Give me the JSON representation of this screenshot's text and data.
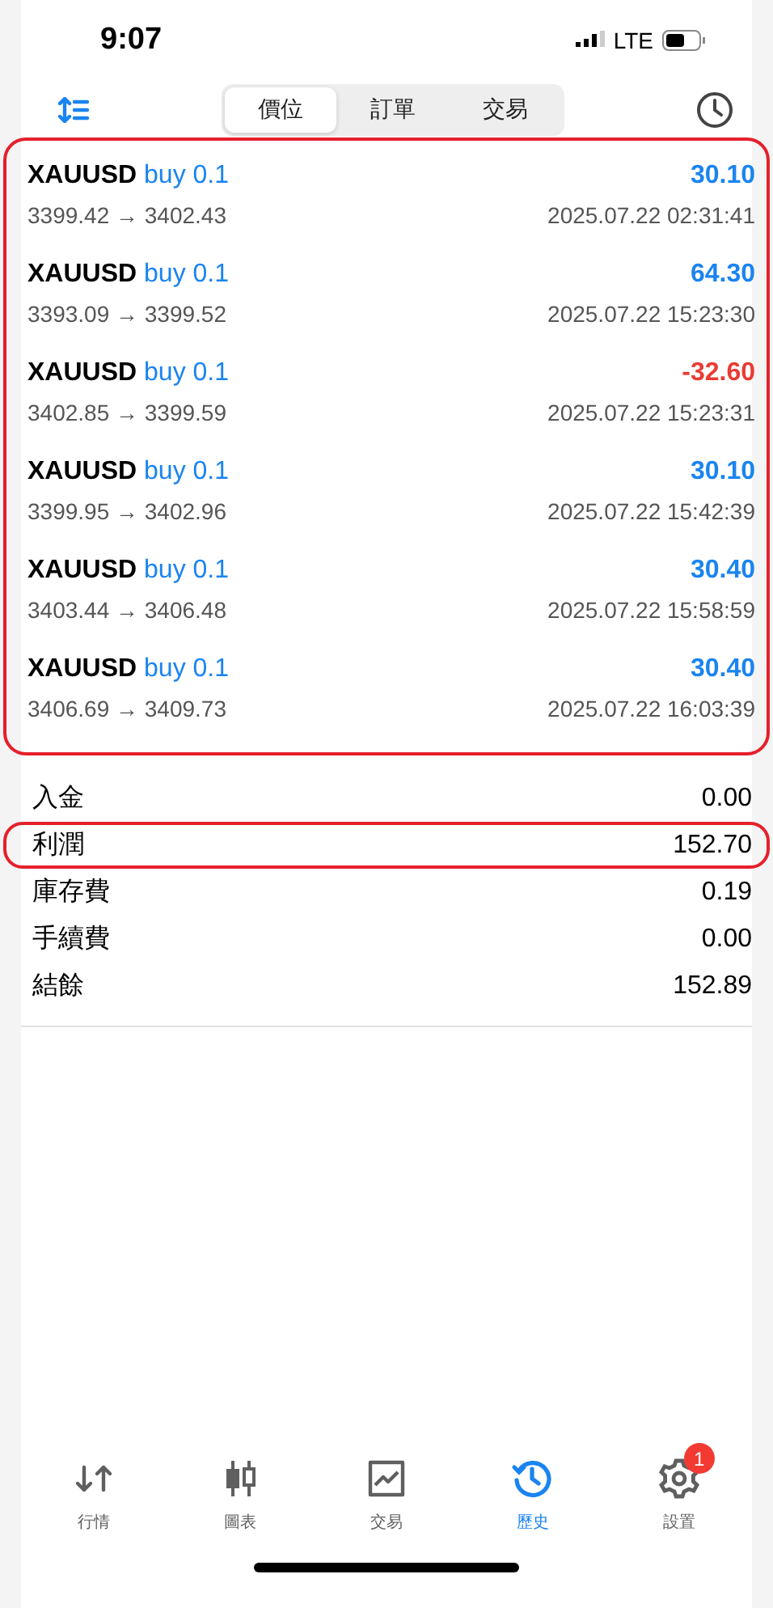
{
  "status_bar": {
    "time": "9:07",
    "network": "LTE"
  },
  "segments": [
    {
      "label": "價位",
      "selected": true
    },
    {
      "label": "訂單",
      "selected": false
    },
    {
      "label": "交易",
      "selected": false
    }
  ],
  "trades_highlighted": true,
  "trades": [
    {
      "symbol": "XAUUSD",
      "side": "buy 0.1",
      "prices": "3399.42 → 3402.43",
      "profit": "30.10",
      "color": "#1a84f0",
      "time": "2025.07.22 02:31:41"
    },
    {
      "symbol": "XAUUSD",
      "side": "buy 0.1",
      "prices": "3393.09 → 3399.52",
      "profit": "64.30",
      "color": "#1a84f0",
      "time": "2025.07.22 15:23:30"
    },
    {
      "symbol": "XAUUSD",
      "side": "buy 0.1",
      "prices": "3402.85 → 3399.59",
      "profit": "-32.60",
      "color": "#ea3b34",
      "time": "2025.07.22 15:23:31"
    },
    {
      "symbol": "XAUUSD",
      "side": "buy 0.1",
      "prices": "3399.95 → 3402.96",
      "profit": "30.10",
      "color": "#1a84f0",
      "time": "2025.07.22 15:42:39"
    },
    {
      "symbol": "XAUUSD",
      "side": "buy 0.1",
      "prices": "3403.44 → 3406.48",
      "profit": "30.40",
      "color": "#1a84f0",
      "time": "2025.07.22 15:58:59"
    },
    {
      "symbol": "XAUUSD",
      "side": "buy 0.1",
      "prices": "3406.69 → 3409.73",
      "profit": "30.40",
      "color": "#1a84f0",
      "time": "2025.07.22 16:03:39"
    }
  ],
  "summary": [
    {
      "label": "入金",
      "value": "0.00",
      "highlighted": false
    },
    {
      "label": "利潤",
      "value": "152.70",
      "highlighted": true
    },
    {
      "label": "庫存費",
      "value": "0.19",
      "highlighted": false
    },
    {
      "label": "手續費",
      "value": "0.00",
      "highlighted": false
    },
    {
      "label": "結餘",
      "value": "152.89",
      "highlighted": false
    }
  ],
  "tab_bar": [
    {
      "kind": "quotes",
      "label": "行情",
      "selected": false
    },
    {
      "kind": "chart",
      "label": "圖表",
      "selected": false
    },
    {
      "kind": "trade",
      "label": "交易",
      "selected": false
    },
    {
      "kind": "history",
      "label": "歷史",
      "selected": true
    },
    {
      "kind": "settings",
      "label": "設置",
      "selected": false,
      "badge": "1"
    }
  ]
}
